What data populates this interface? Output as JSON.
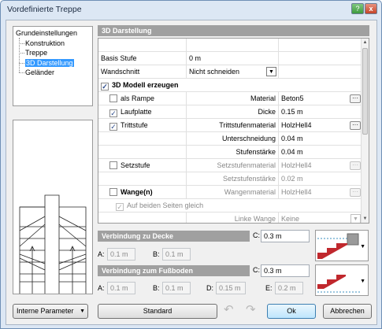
{
  "window": {
    "title": "Vordefinierte Treppe",
    "help_label": "?",
    "close_label": "x"
  },
  "tree": {
    "root": "Grundeinstellungen",
    "items": [
      "Konstruktion",
      "Treppe",
      "3D Darstellung",
      "Geländer"
    ],
    "selected": "3D Darstellung"
  },
  "section_3d": {
    "title": "3D Darstellung"
  },
  "grid": {
    "basis_stufe": {
      "label": "Basis Stufe",
      "value": "0 m"
    },
    "wandschnitt": {
      "label": "Wandschnitt",
      "value": "Nicht schneiden"
    },
    "modell": {
      "label": "3D Modell erzeugen",
      "checked": true
    },
    "rampe": {
      "label": "als Rampe",
      "checked": false,
      "prop": "Material",
      "value": "Beton5"
    },
    "laufplatte": {
      "label": "Laufplatte",
      "checked": true,
      "prop": "Dicke",
      "value": "0.15 m"
    },
    "trittstufe": {
      "label": "Trittstufe",
      "checked": true,
      "prop": "Trittstufenmaterial",
      "value": "HolzHell4"
    },
    "unterschneidung": {
      "prop": "Unterschneidung",
      "value": "0.04 m"
    },
    "stufenstaerke": {
      "prop": "Stufenstärke",
      "value": "0.04 m"
    },
    "setzstufe": {
      "label": "Setzstufe",
      "checked": false,
      "prop": "Setzstufenmaterial",
      "value": "HolzHell4"
    },
    "setzstufenstaerke": {
      "prop": "Setzstufenstärke",
      "value": "0.02 m"
    },
    "wange": {
      "label": "Wange(n)",
      "checked": false,
      "prop": "Wangenmaterial",
      "value": "HolzHell4"
    },
    "beiden_seiten": {
      "label": "Auf beiden Seiten gleich",
      "checked": true
    },
    "linke_wange": {
      "prop": "Linke Wange",
      "value": "Keine"
    }
  },
  "decke": {
    "title": "Verbindung zu Decke",
    "c_label": "C:",
    "c_value": "0.3 m",
    "a_label": "A:",
    "a_value": "0.1 m",
    "b_label": "B:",
    "b_value": "0.1 m"
  },
  "boden": {
    "title": "Verbindung zum Fußboden",
    "c_label": "C:",
    "c_value": "0.3 m",
    "a_label": "A:",
    "a_value": "0.1 m",
    "b_label": "B:",
    "b_value": "0.1 m",
    "d_label": "D:",
    "d_value": "0.15 m",
    "e_label": "E:",
    "e_value": "0.2 m"
  },
  "footer": {
    "params_dropdown": "Interne Parameter",
    "standard": "Standard",
    "ok": "Ok",
    "cancel": "Abbrechen"
  },
  "colors": {
    "accent": "#3399ff",
    "stair_red": "#c0282d",
    "header_gray": "#a0a0a0"
  }
}
